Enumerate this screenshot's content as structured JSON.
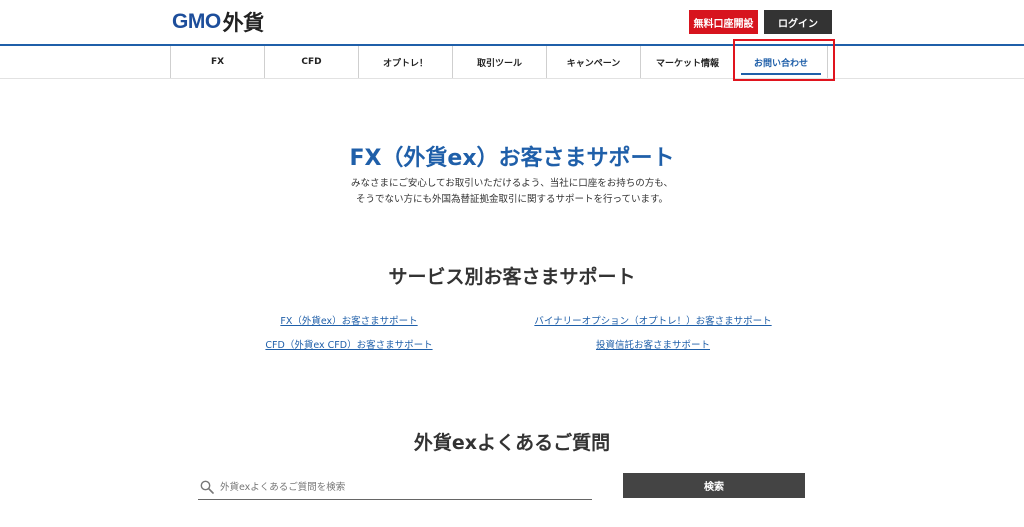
{
  "header": {
    "logo_gmo": "GMO",
    "logo_gaika": "外貨",
    "open_account_label": "無料口座開設",
    "login_label": "ログイン"
  },
  "nav": {
    "items": [
      "FX",
      "CFD",
      "オプトレ！",
      "取引ツール",
      "キャンペーン",
      "マーケット情報",
      "お問い合わせ"
    ],
    "active": "お問い合わせ"
  },
  "main": {
    "title": "FX（外貨ex）お客さまサポート",
    "desc_line1": "みなさまにご安心してお取引いただけるよう、当社に口座をお持ちの方も、",
    "desc_line2": "そうでない方にも外国為替証拠金取引に関するサポートを行っています。",
    "service_heading": "サービス別お客さまサポート",
    "service_links": [
      "FX（外貨ex）お客さまサポート",
      "バイナリーオプション（オプトレ！）お客さまサポート",
      "CFD（外貨ex CFD）お客さまサポート",
      "投資信託お客さまサポート"
    ],
    "faq_heading": "外貨exよくあるご質問",
    "search_placeholder": "外貨exよくあるご質問を検索",
    "search_button": "検索"
  },
  "colors": {
    "brand_blue": "#1f5fa9",
    "open_account_red": "#d7141e",
    "highlight_red": "#e0141e",
    "dark_button": "#333333"
  },
  "icons": [
    "search-icon"
  ]
}
